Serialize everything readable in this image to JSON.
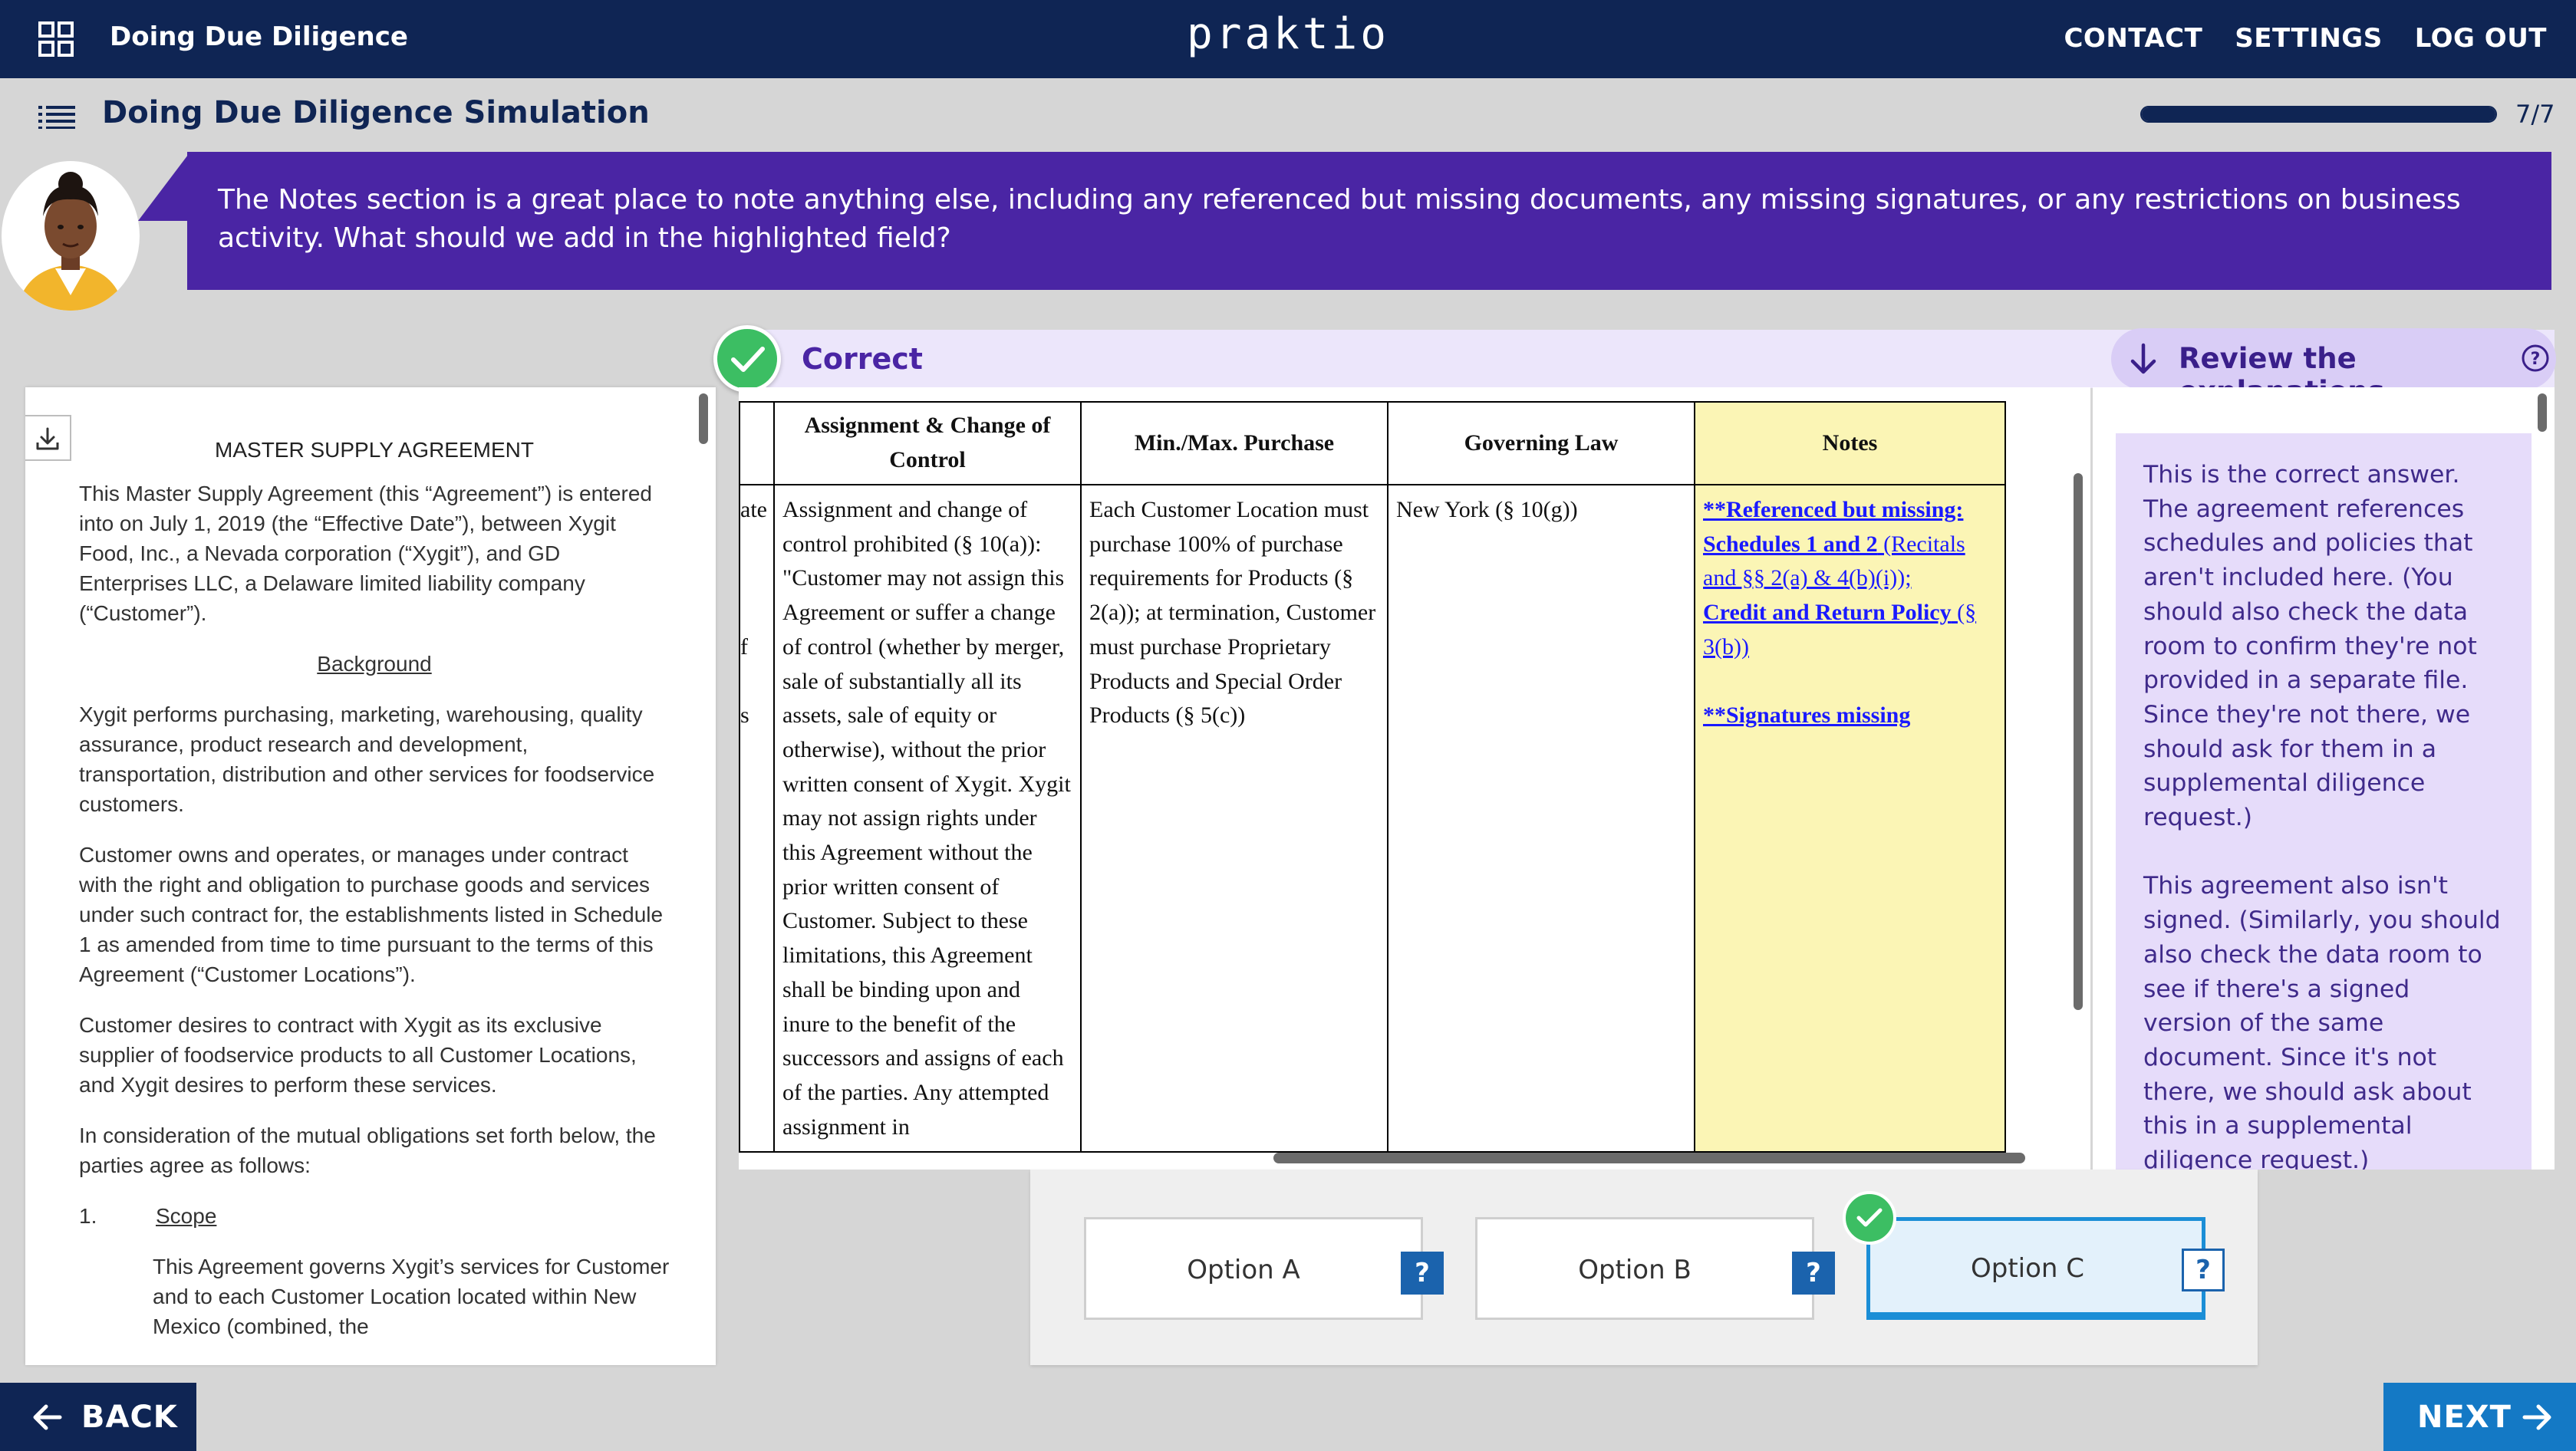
{
  "topbar": {
    "course_title": "Doing Due Diligence",
    "brand": "praktio",
    "nav": {
      "contact": "CONTACT",
      "settings": "SETTINGS",
      "logout": "LOG OUT"
    }
  },
  "subheader": {
    "title": "Doing Due Diligence Simulation",
    "progress_text": "7/7",
    "progress_fraction": 1.0
  },
  "instruction": {
    "text": "The Notes section is a great place to note anything else, including any referenced but missing documents, any missing signatures, or any restrictions on business activity. What should we add in the highlighted field?"
  },
  "feedback": {
    "status": "Correct",
    "review_label": "Review the explanations"
  },
  "document": {
    "heading": "MASTER SUPPLY AGREEMENT",
    "intro": "This Master Supply Agreement (this “Agreement”) is entered into on July 1, 2019 (the “Effective Date”), between Xygit Food, Inc., a Nevada corporation (“Xygit”), and GD Enterprises LLC, a Delaware limited liability company (“Customer”).",
    "background_heading": "Background",
    "para1": "Xygit performs purchasing, marketing, warehousing, quality assurance, product research and development, transportation, distribution and other services for foodservice customers.",
    "para2": "Customer owns and operates, or manages under contract with the right and obligation to purchase goods and services under such contract for, the establishments listed in Schedule 1 as amended from time to time pursuant to the terms of this Agreement (“Customer Locations”).",
    "para3": "Customer desires to contract with Xygit as its exclusive supplier of foodservice products to all Customer Locations, and Xygit desires to perform these services.",
    "para4": "In consideration of the mutual obligations set forth below, the parties agree as follows:",
    "section_num": "1.",
    "section_title": "Scope",
    "section_text": "This Agreement governs Xygit’s services for Customer and to each Customer Location located within New Mexico (combined, the"
  },
  "table": {
    "headers": {
      "assignment": "Assignment & Change of Control",
      "minmax": "Min./Max. Purchase",
      "law": "Governing Law",
      "notes": "Notes"
    },
    "clipped_fragments": [
      "ate",
      "",
      "",
      "",
      "f",
      "",
      "s"
    ],
    "assignment_text": "Assignment and change of control prohibited (§ 10(a)): \"Customer may not assign this Agreement or suffer a change of control (whether by merger, sale of substantially all its assets, sale of equity or otherwise), without the prior written consent of Xygit.  Xygit may not assign rights under this Agreement without the prior written consent of Customer. Subject to these limitations, this Agreement shall be binding upon and inure to the benefit of the successors and assigns of each of the parties. Any attempted assignment in",
    "minmax_text": "Each Customer Location must purchase 100% of purchase requirements for Products (§ 2(a)); at termination, Customer must purchase Proprietary Products and Special Order Products (§ 5(c))",
    "law_text": "New York (§ 10(g))",
    "notes": {
      "missing_label": "**Referenced but missing:",
      "schedules": "Schedules 1 and 2",
      "schedules_ref": " (Recitals and §§ 2(a) & 4(b)(i));",
      "policy": "Credit and Return Policy",
      "policy_ref": " (§ 3(b))",
      "signatures": "**Signatures missing"
    }
  },
  "explanation": {
    "para1": "This is the correct answer. The agreement references schedules and policies that aren't included here. (You should also check the data room to confirm they're not provided in a separate file. Since they're not there, we should ask for them in a supplemental diligence request.)",
    "para2": "This agreement also isn't signed. (Similarly, you should also check the data room to see if there's a signed version of the same document. Since it's not there, we should ask about this in a supplemental diligence request.)"
  },
  "options": [
    {
      "label": "Option A",
      "help": "?"
    },
    {
      "label": "Option B",
      "help": "?"
    },
    {
      "label": "Option C",
      "help": "?",
      "selected": true
    }
  ],
  "footer": {
    "back": "BACK",
    "next": "NEXT"
  },
  "colors": {
    "navy": "#0f2554",
    "purple": "#4a25a4",
    "success": "#3cbe63",
    "accent_blue": "#1479c5",
    "notes_highlight": "#fbf5b5"
  },
  "icons": [
    "grid-icon",
    "menu-icon",
    "check-icon",
    "arrow-down-icon",
    "help-icon",
    "download-icon",
    "arrow-left-icon",
    "arrow-right-icon"
  ]
}
